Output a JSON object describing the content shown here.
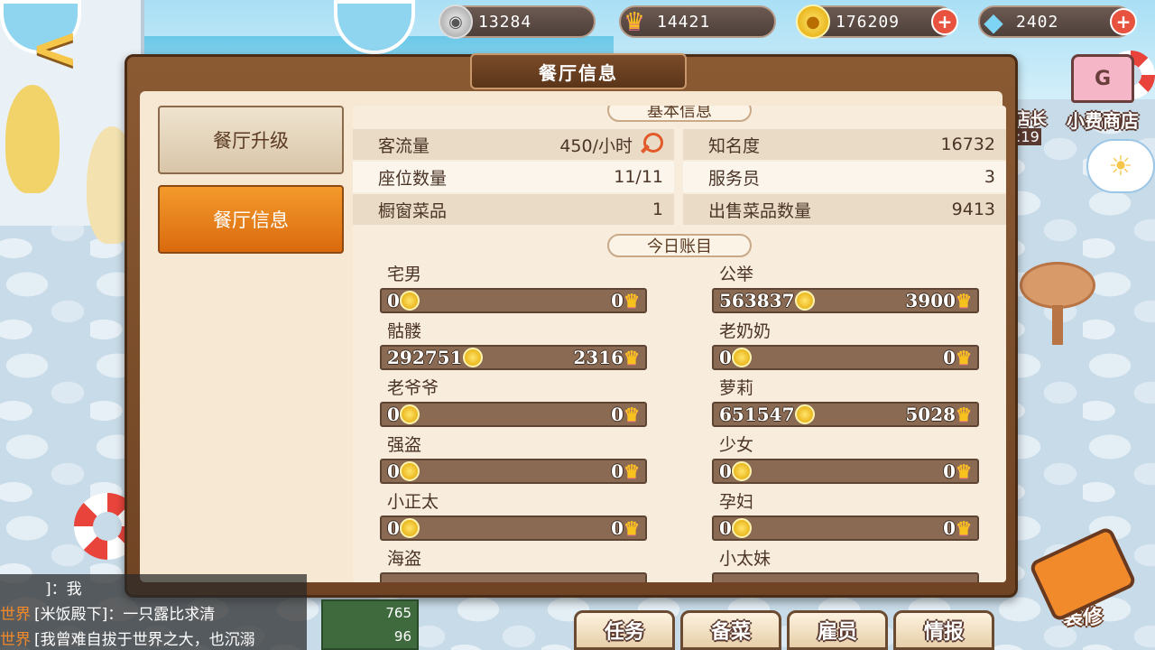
{
  "resources": {
    "silver": "13284",
    "crowns": "14421",
    "gold": "176209",
    "gems": "2402"
  },
  "dialog": {
    "title": "餐厅信息",
    "tabs": [
      {
        "label": "餐厅升级",
        "active": false
      },
      {
        "label": "餐厅信息",
        "active": true
      }
    ]
  },
  "basic_info": {
    "header": "基本信息",
    "rows": [
      {
        "left_label": "客流量",
        "left_value": "450/小时",
        "right_label": "知名度",
        "right_value": "16732"
      },
      {
        "left_label": "座位数量",
        "left_value": "11/11",
        "right_label": "服务员",
        "right_value": "3"
      },
      {
        "left_label": "橱窗菜品",
        "left_value": "1",
        "right_label": "出售菜品数量",
        "right_value": "9413"
      }
    ]
  },
  "today_account": {
    "header": "今日账目",
    "customers": [
      {
        "name": "宅男",
        "gold": "0",
        "crowns": "0"
      },
      {
        "name": "公举",
        "gold": "563837",
        "crowns": "3900"
      },
      {
        "name": "骷髅",
        "gold": "292751",
        "crowns": "2316"
      },
      {
        "name": "老奶奶",
        "gold": "0",
        "crowns": "0"
      },
      {
        "name": "老爷爷",
        "gold": "0",
        "crowns": "0"
      },
      {
        "name": "萝莉",
        "gold": "651547",
        "crowns": "5028"
      },
      {
        "name": "强盗",
        "gold": "0",
        "crowns": "0"
      },
      {
        "name": "少女",
        "gold": "0",
        "crowns": "0"
      },
      {
        "name": "小正太",
        "gold": "0",
        "crowns": "0"
      },
      {
        "name": "孕妇",
        "gold": "0",
        "crowns": "0"
      },
      {
        "name": "海盗",
        "gold": "",
        "crowns": ""
      },
      {
        "name": "小太妹",
        "gold": "",
        "crowns": ""
      }
    ]
  },
  "side": {
    "shop_label": "小费商店",
    "partial_label": "店长",
    "partial_time": ":19"
  },
  "chat": {
    "lines": [
      {
        "channel": "",
        "text": "]：我"
      },
      {
        "channel": "世界",
        "text": "[米饭殿下]：一只露比求清"
      },
      {
        "channel": "世界",
        "text": "[我曾难自拔于世界之大，也沉溺"
      }
    ]
  },
  "mini_stats": {
    "a": "765",
    "b": "96"
  },
  "bottom_buttons": [
    "任务",
    "备菜",
    "雇员",
    "情报"
  ],
  "decorate_label": "装修",
  "colors": {
    "accent_orange": "#d96a0e",
    "panel_brown": "#6f4424",
    "bar_brown": "#8a6a52"
  }
}
